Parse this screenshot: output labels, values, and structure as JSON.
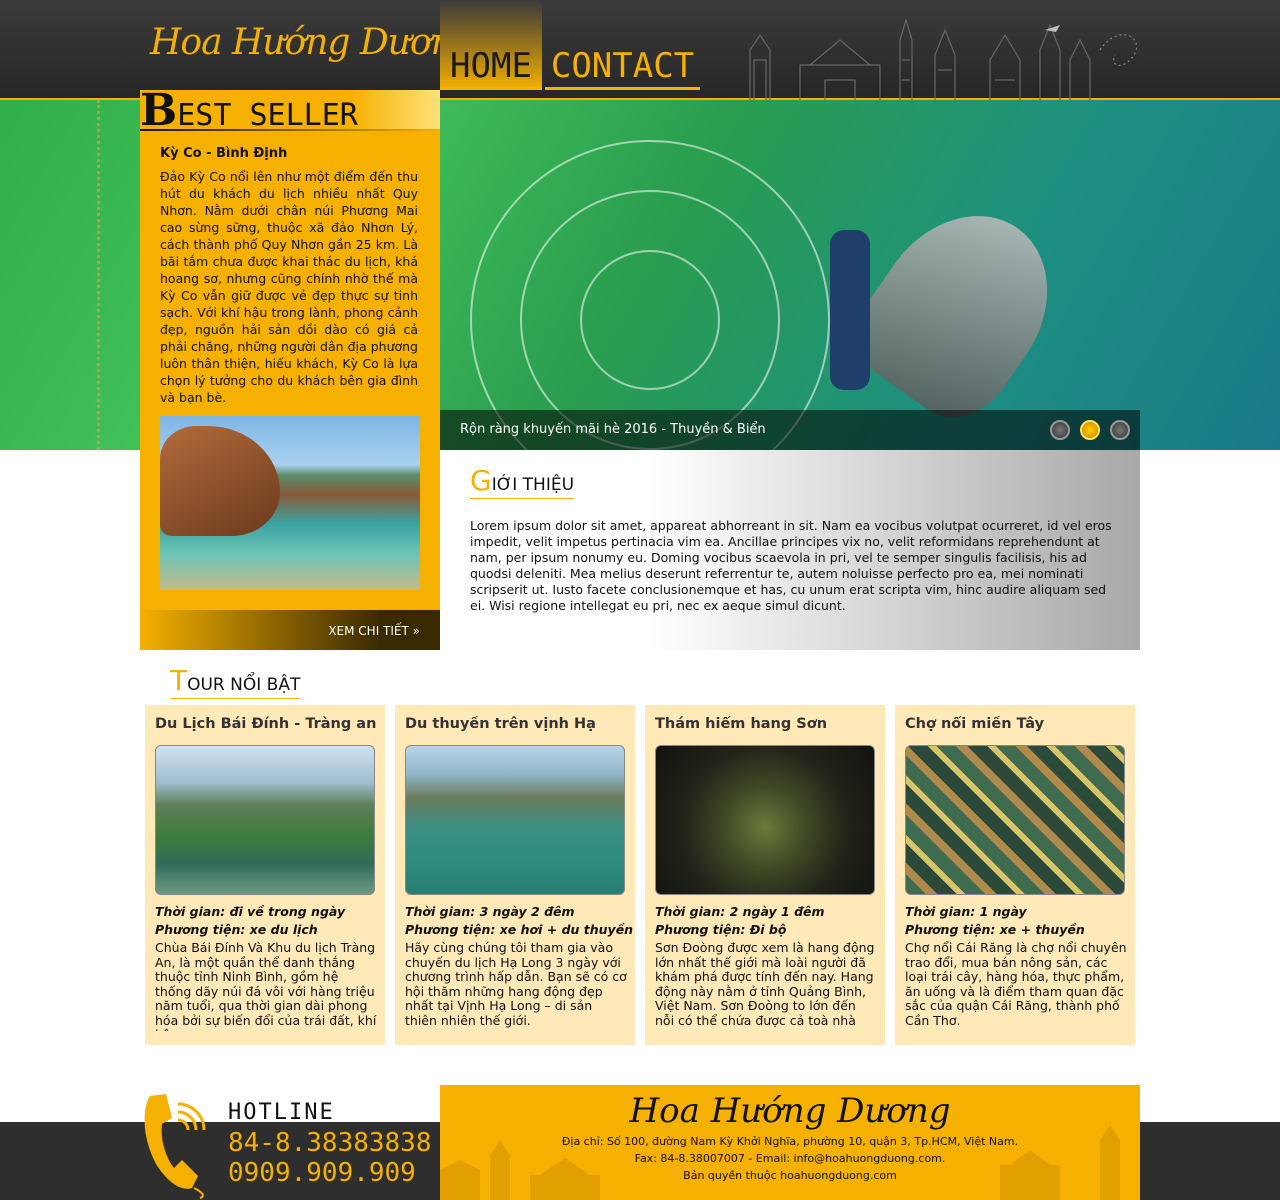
{
  "header": {
    "logo": "Hoa Hướng Dương",
    "nav": [
      {
        "label": "HOME",
        "active": true
      },
      {
        "label": "CONTACT",
        "active": false
      }
    ]
  },
  "banner": {
    "caption": "Rộn ràng khuyến mãi hè 2016 - Thuyền & Biển",
    "slides": 3,
    "active_slide": 2
  },
  "bestseller": {
    "title_first": "B",
    "title_rest": "EST SELLER",
    "heading": "Kỳ Co - Bình Định",
    "text": "Đảo Kỳ Co nổi lên như một điểm đến thu hút du khách du lịch nhiều nhất Quy Nhơn. Nằm dưới chân núi Phương Mai cao sừng sững, thuộc xã đảo Nhơn Lý, cách thành phố Quy Nhơn gần 25 km. Là bãi tắm chưa được khai thác du lịch, khá hoang sơ, nhưng cũng chính nhờ thế mà Kỳ Co vẫn giữ được vẻ đẹp thực sự tinh sạch. Với khí hậu trong lành, phong cảnh đẹp, nguồn hải sản dồi dào có giá cả phải chăng, những người dân địa phương luôn thân thiện, hiếu khách, Kỳ Co là lựa chọn lý tưởng cho du khách bên gia đình và bạn bè.",
    "more": "XEM CHI TIẾT »"
  },
  "intro": {
    "title_first": "G",
    "title_rest": "IỚI THIỆU",
    "text": "Lorem ipsum dolor sit amet, appareat abhorreant in sit. Nam ea vocibus volutpat ocurreret, id vel eros impedit, velit impetus pertinacia vim ea. Ancillae principes vix no, velit reformidans reprehendunt at nam, per ipsum nonumy eu. Doming vocibus scaevola in pri, vel te semper singulis facilisis, his ad quodsi deleniti. Mea melius deserunt referrentur te, autem noluisse perfecto pro ea, mei nominati scripserit ut. Iusto facete conclusionemque et has, cu unum erat scripta vim, hinc audire aliquam sed ei. Wisi regione intellegat eu pri, nec ex aeque simul dicunt."
  },
  "tours_section": {
    "title_first": "T",
    "title_rest": "OUR NỔI BẬT"
  },
  "tours": [
    {
      "title": "Du Lịch Bái Đính - Tràng an",
      "time": "Thời gian: đi về trong ngày",
      "transport": "Phương tiện: xe du lịch",
      "desc": "Chùa Bái Đính Và Khu du lịch Tràng An, là một quần thể danh thắng thuộc tỉnh Ninh Bình, gồm hệ thống dãy núi đá vôi với hàng triệu năm tuổi, qua thời gian dài phong hóa bởi sự biến đổi của trái đất, khí hậu,"
    },
    {
      "title": "Du thuyền trên vịnh Hạ",
      "time": "Thời gian: 3 ngày 2 đêm",
      "transport": "Phương tiện: xe hơi + du thuyền",
      "desc": "Hãy cùng chúng tôi tham gia vào chuyến du lịch Hạ Long 3 ngày với chương trình hấp dẫn. Bạn sẽ có cơ hội thăm những hang động đẹp nhất tại Vịnh Hạ Long – di sản thiên nhiên thế giới."
    },
    {
      "title": "Thám hiểm hang Sơn",
      "time": "Thời gian: 2 ngày 1 đêm",
      "transport": "Phương tiện: Đi bộ",
      "desc": "Sơn Đoòng được xem là hang động lớn nhất thế giới mà loài người đã khám phá được tính đến nay. Hang động này nằm ở tỉnh Quảng Bình, Việt Nam. Sơn Đoòng to lớn đến nỗi có thể chứa được cả toà nhà cao"
    },
    {
      "title": "Chợ nổi miền Tây",
      "time": "Thời gian: 1 ngày",
      "transport": "Phương tiện: xe + thuyền",
      "desc": "Chợ nổi Cái Răng là chợ nổi chuyên trao đổi, mua bán nông sản, các loại trái cây, hàng hóa, thực phẩm, ăn uống và là điểm tham quan đặc sắc của quận Cái Răng, thành phố Cần Thơ."
    }
  ],
  "footer": {
    "hotline_label": "HOTLINE",
    "phone1": "84-8.38383838",
    "phone2": "0909.909.909",
    "logo": "Hoa Hướng Dương",
    "address": "Địa chỉ: Số 100, đường Nam Kỳ Khởi Nghĩa, phường 10, quận 3, Tp.HCM, Việt Nam.",
    "contact": "Fax: 84-8.38007007 - Email: info@hoahuongduong.com.",
    "copyright": "Bản quyền thuộc hoahuongduong.com"
  },
  "colors": {
    "accent": "#f5b000",
    "dark": "#2e2e2e",
    "card": "#ffe9b8"
  }
}
